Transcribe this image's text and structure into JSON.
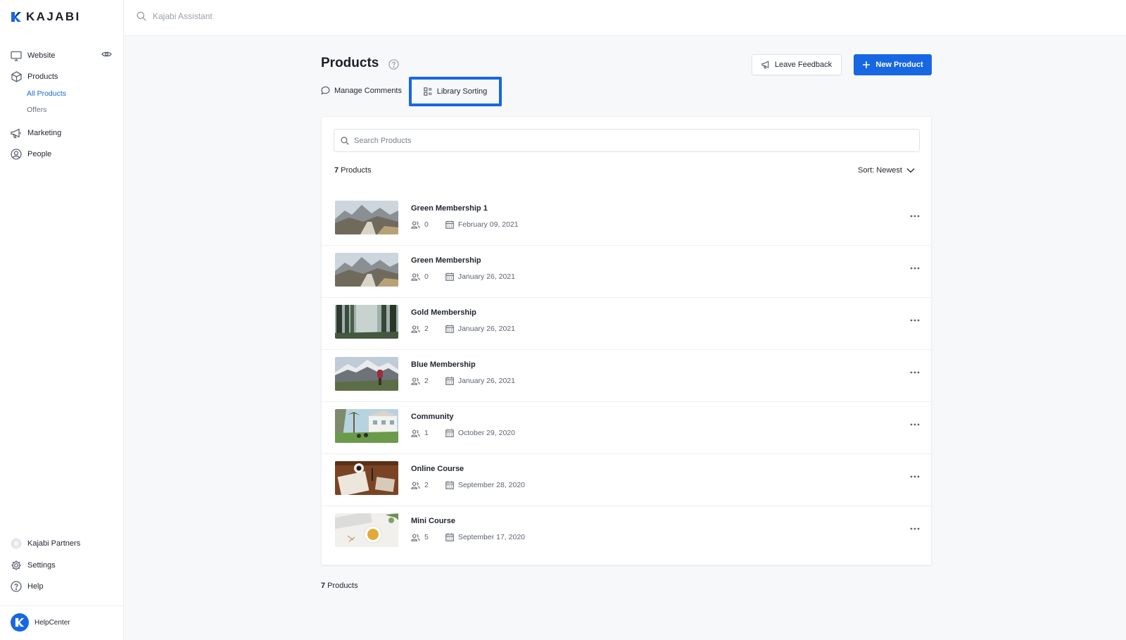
{
  "brand": {
    "name": "KAJABI",
    "accent": "#1767e3"
  },
  "sidebar": {
    "website": "Website",
    "products": "Products",
    "all_products": "All Products",
    "offers": "Offers",
    "marketing": "Marketing",
    "people": "People",
    "partners": "Kajabi Partners",
    "settings": "Settings",
    "help": "Help",
    "helpcenter": "HelpCenter"
  },
  "topbar": {
    "assistant_placeholder": "Kajabi Assistant"
  },
  "main": {
    "title": "Products",
    "leave_feedback": "Leave Feedback",
    "new_product": "New Product",
    "manage_comments": "Manage Comments",
    "library_sorting": "Library Sorting",
    "search_placeholder": "Search Products",
    "count_number": "7",
    "count_label": " Products",
    "sort_label": "Sort: Newest",
    "footer_count_number": "7",
    "footer_count_label": " Products"
  },
  "products": [
    {
      "name": "Green Membership 1",
      "members": "0",
      "date": "February 09, 2021",
      "thumb": "mountain-path"
    },
    {
      "name": "Green Membership",
      "members": "0",
      "date": "January 26, 2021",
      "thumb": "mountain-path"
    },
    {
      "name": "Gold Membership",
      "members": "2",
      "date": "January 26, 2021",
      "thumb": "forest"
    },
    {
      "name": "Blue Membership",
      "members": "2",
      "date": "January 26, 2021",
      "thumb": "mountain-hiker"
    },
    {
      "name": "Community",
      "members": "1",
      "date": "October 29, 2020",
      "thumb": "palm-house"
    },
    {
      "name": "Online Course",
      "members": "2",
      "date": "September 28, 2020",
      "thumb": "desk-coffee"
    },
    {
      "name": "Mini Course",
      "members": "5",
      "date": "September 17, 2020",
      "thumb": "tea-keyboard"
    }
  ]
}
